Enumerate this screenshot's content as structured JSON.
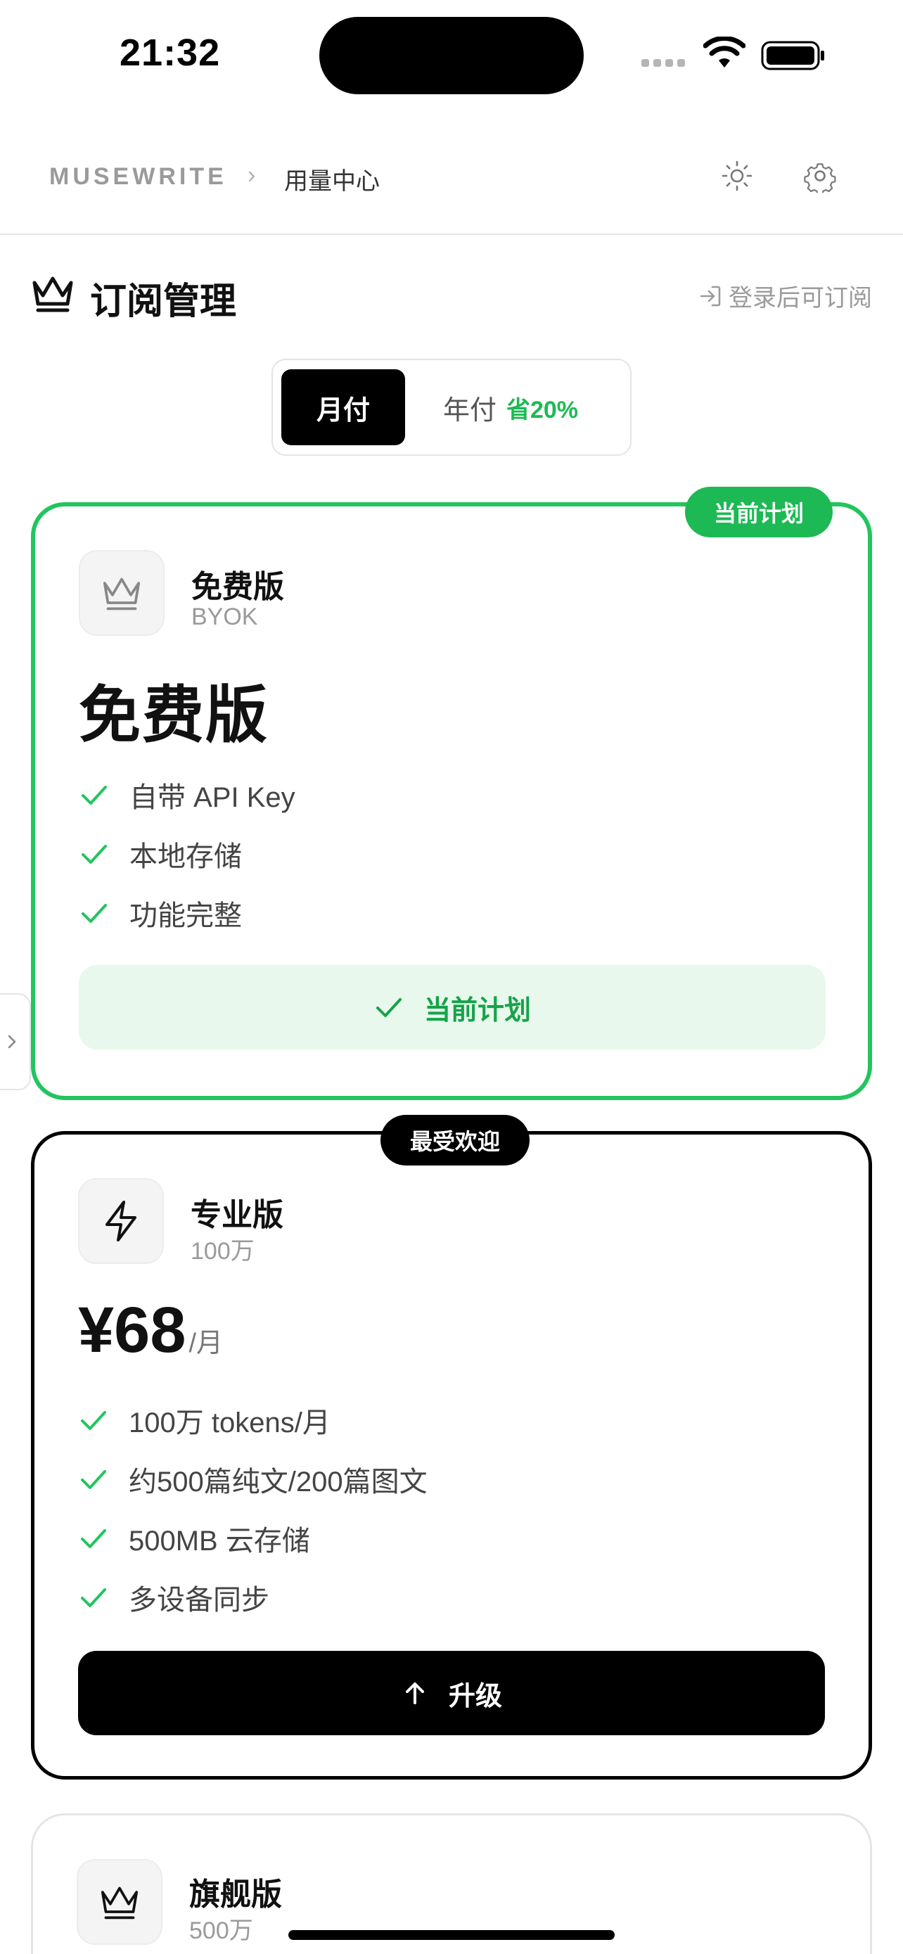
{
  "status_bar": {
    "time": "21:32"
  },
  "nav": {
    "brand": "MUSEWRITE",
    "separator": "›",
    "page": "用量中心",
    "icons": [
      "sun-icon",
      "gear-icon"
    ]
  },
  "section": {
    "title": "订阅管理",
    "login_link": "登录后可订阅"
  },
  "billing_toggle": {
    "monthly": "月付",
    "yearly": "年付",
    "yearly_discount": "省20%",
    "selected": "monthly"
  },
  "plans": [
    {
      "badge": "当前计划",
      "name": "免费版",
      "subtitle": "BYOK",
      "headline": "免费版",
      "features": [
        "自带 API Key",
        "本地存储",
        "功能完整"
      ],
      "button_label": "当前计划",
      "icon": "crown-icon"
    },
    {
      "badge": "最受欢迎",
      "name": "专业版",
      "subtitle": "100万",
      "price": "¥68",
      "price_unit": "/月",
      "features": [
        "100万 tokens/月",
        "约500篇纯文/200篇图文",
        "500MB 云存储",
        "多设备同步"
      ],
      "button_label": "升级",
      "icon": "lightning-icon"
    },
    {
      "name": "旗舰版",
      "subtitle": "500万",
      "icon": "crown-icon"
    }
  ],
  "colors": {
    "accent_green": "#1db954",
    "current_bg": "#e8f8ec",
    "primary": "#000000"
  }
}
